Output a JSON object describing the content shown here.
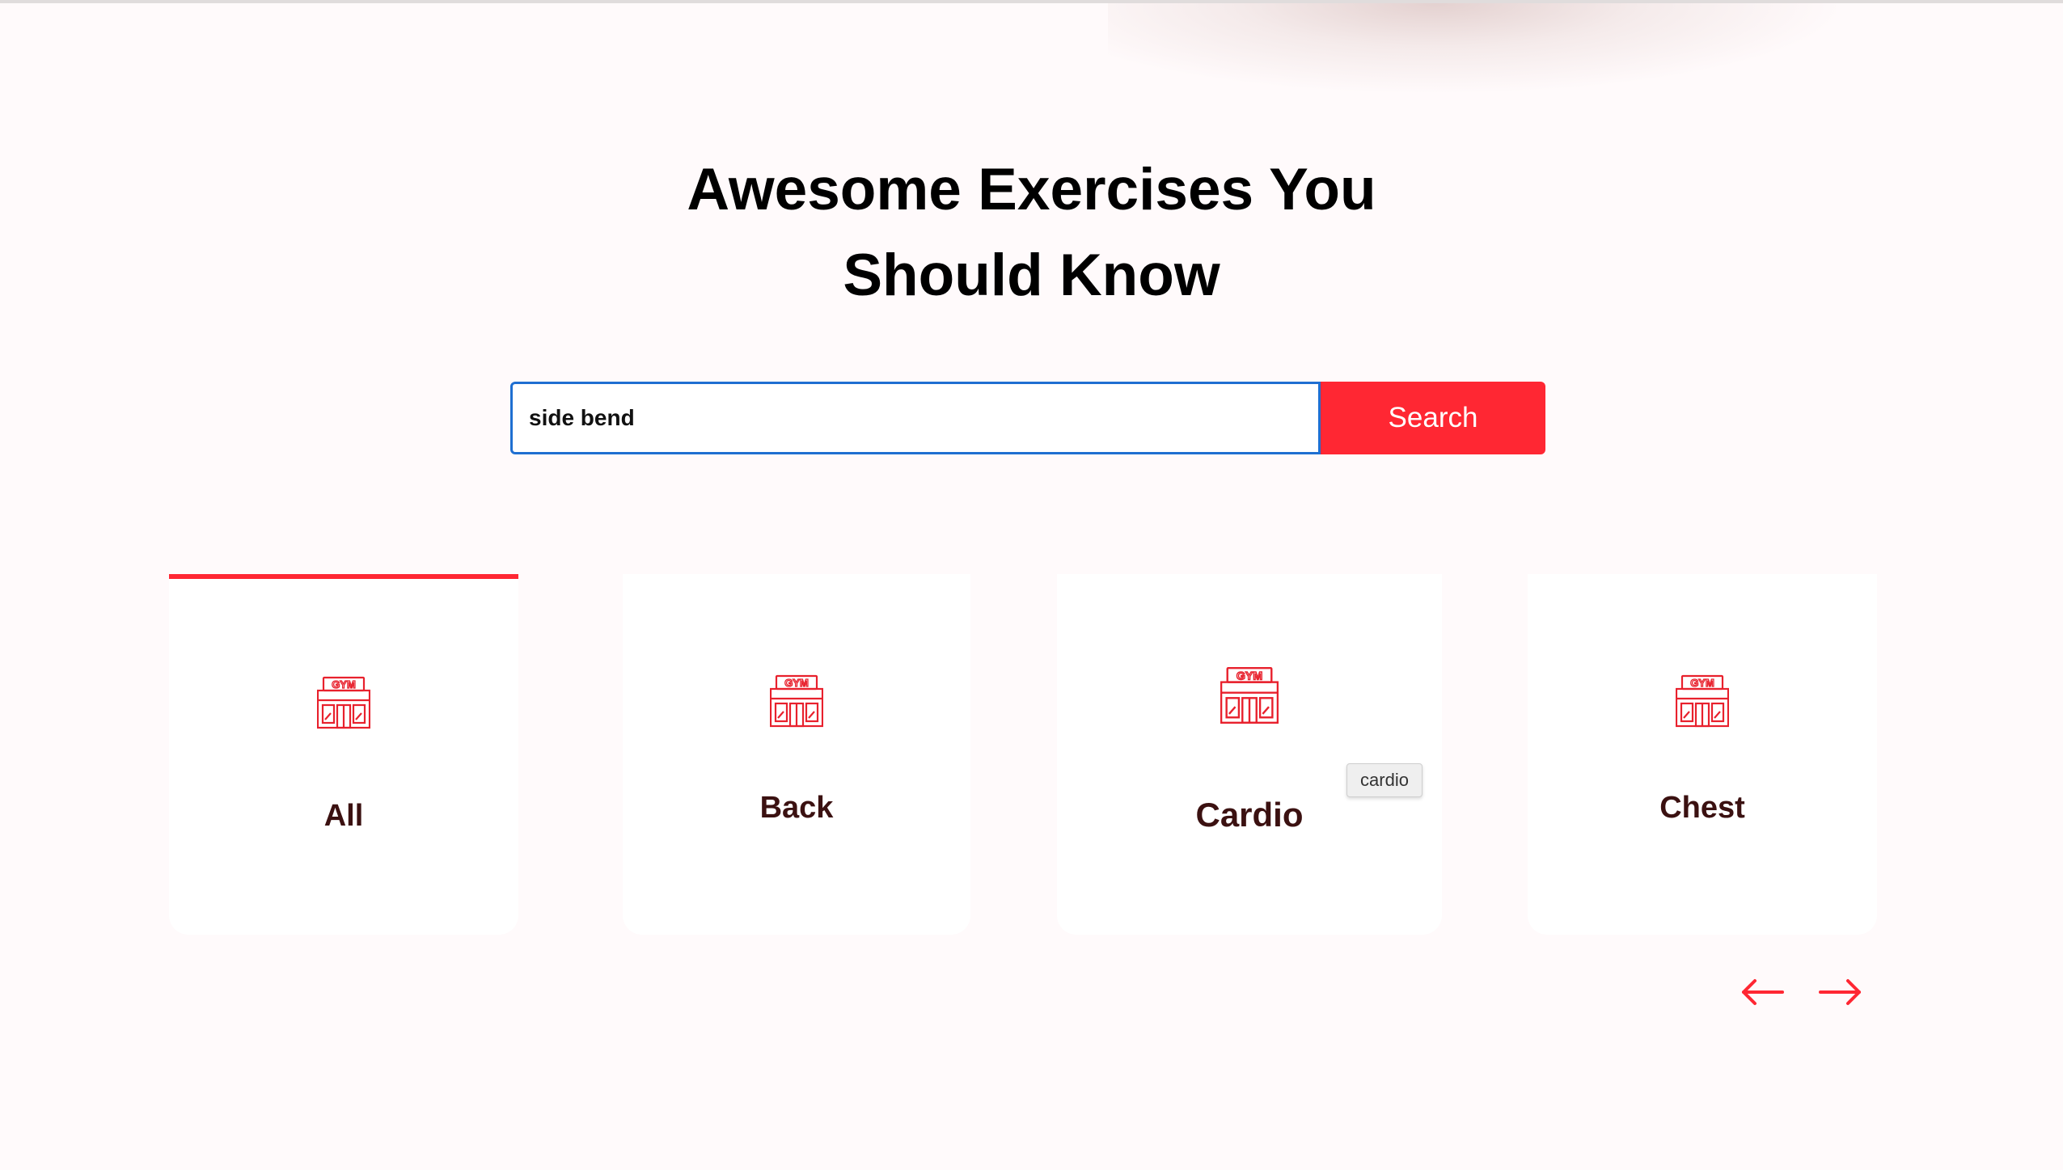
{
  "hero": {
    "title_line1": "Awesome Exercises You",
    "title_line2": "Should Know"
  },
  "search": {
    "value": "side bend",
    "button_label": "Search"
  },
  "categories": [
    {
      "label": "All",
      "icon": "gym-icon",
      "active": true
    },
    {
      "label": "Back",
      "icon": "gym-icon",
      "active": false
    },
    {
      "label": "Cardio",
      "icon": "gym-icon",
      "active": false
    },
    {
      "label": "Chest",
      "icon": "gym-icon",
      "active": false
    }
  ],
  "tooltip": {
    "text": "cardio"
  },
  "pagination": {
    "prev_icon": "arrow-left-icon",
    "next_icon": "arrow-right-icon"
  },
  "colors": {
    "accent": "#ff2733",
    "label": "#3b1111",
    "background": "#fffafb",
    "focus_border": "#1f6fd1"
  }
}
